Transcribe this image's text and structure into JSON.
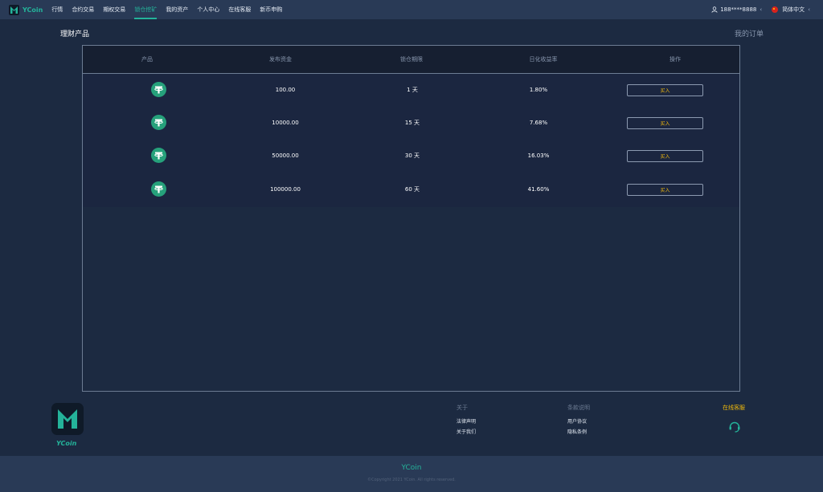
{
  "nav": {
    "brand": "YCoin",
    "items": [
      "行情",
      "合约交易",
      "期权交易",
      "锁仓挖矿",
      "我的资产",
      "个人中心",
      "在线客服",
      "新币申购"
    ],
    "active_index": 3,
    "user": "188****8888",
    "language": "简体中文"
  },
  "page": {
    "title": "理财产品",
    "my_orders": "我的订单"
  },
  "table": {
    "headers": [
      "产品",
      "发布资金",
      "锁仓期限",
      "日化收益率",
      "操作"
    ],
    "rows": [
      {
        "amount": "100.00",
        "period": "1 天",
        "rate": "1.80%",
        "action": "买入"
      },
      {
        "amount": "10000.00",
        "period": "15 天",
        "rate": "7.68%",
        "action": "买入"
      },
      {
        "amount": "50000.00",
        "period": "30 天",
        "rate": "16.03%",
        "action": "买入"
      },
      {
        "amount": "100000.00",
        "period": "60 天",
        "rate": "41.60%",
        "action": "买入"
      }
    ],
    "coin_icon": "tether-usdt-icon"
  },
  "footer": {
    "brand": "YCoin",
    "about_title": "关于",
    "about_links": [
      "法律声明",
      "关于我们"
    ],
    "terms_title": "条款说明",
    "terms_links": [
      "用户协议",
      "隐私条例"
    ],
    "service_title": "在线客服",
    "bottom_brand": "YCoin",
    "copyright": "©Copyright 2021 YCoin. All rights reserved."
  },
  "colors": {
    "accent": "#24b39a",
    "gold": "#f0b90b",
    "background": "#1c2a41",
    "topbar": "#293a56"
  }
}
